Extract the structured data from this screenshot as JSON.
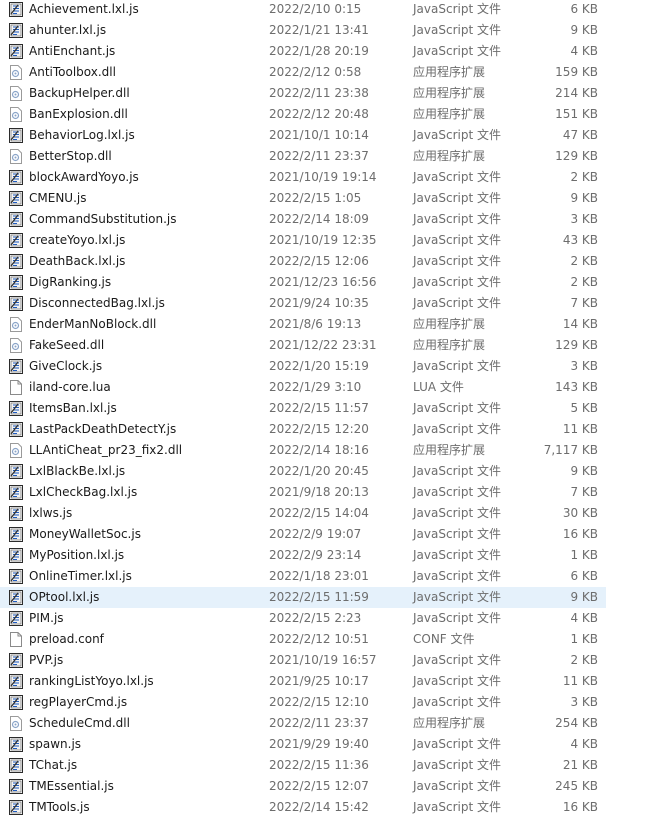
{
  "files": [
    {
      "name": "Achievement.lxl.js",
      "date": "2022/2/10 0:15",
      "type": "JavaScript 文件",
      "size": "6 KB",
      "icon": "javascript-file-icon"
    },
    {
      "name": "ahunter.lxl.js",
      "date": "2022/1/21 13:41",
      "type": "JavaScript 文件",
      "size": "9 KB",
      "icon": "javascript-file-icon"
    },
    {
      "name": "AntiEnchant.js",
      "date": "2022/1/28 20:19",
      "type": "JavaScript 文件",
      "size": "4 KB",
      "icon": "javascript-file-icon"
    },
    {
      "name": "AntiToolbox.dll",
      "date": "2022/2/12 0:58",
      "type": "应用程序扩展",
      "size": "159 KB",
      "icon": "dll-file-icon"
    },
    {
      "name": "BackupHelper.dll",
      "date": "2022/2/11 23:38",
      "type": "应用程序扩展",
      "size": "214 KB",
      "icon": "dll-file-icon"
    },
    {
      "name": "BanExplosion.dll",
      "date": "2022/2/12 20:48",
      "type": "应用程序扩展",
      "size": "151 KB",
      "icon": "dll-file-icon"
    },
    {
      "name": "BehaviorLog.lxl.js",
      "date": "2021/10/1 10:14",
      "type": "JavaScript 文件",
      "size": "47 KB",
      "icon": "javascript-file-icon"
    },
    {
      "name": "BetterStop.dll",
      "date": "2022/2/11 23:37",
      "type": "应用程序扩展",
      "size": "129 KB",
      "icon": "dll-file-icon"
    },
    {
      "name": "blockAwardYoyo.js",
      "date": "2021/10/19 19:14",
      "type": "JavaScript 文件",
      "size": "2 KB",
      "icon": "javascript-file-icon"
    },
    {
      "name": "CMENU.js",
      "date": "2022/2/15 1:05",
      "type": "JavaScript 文件",
      "size": "9 KB",
      "icon": "javascript-file-icon"
    },
    {
      "name": "CommandSubstitution.js",
      "date": "2022/2/14 18:09",
      "type": "JavaScript 文件",
      "size": "3 KB",
      "icon": "javascript-file-icon"
    },
    {
      "name": "createYoyo.lxl.js",
      "date": "2021/10/19 12:35",
      "type": "JavaScript 文件",
      "size": "43 KB",
      "icon": "javascript-file-icon"
    },
    {
      "name": "DeathBack.lxl.js",
      "date": "2022/2/15 12:06",
      "type": "JavaScript 文件",
      "size": "2 KB",
      "icon": "javascript-file-icon"
    },
    {
      "name": "DigRanking.js",
      "date": "2021/12/23 16:56",
      "type": "JavaScript 文件",
      "size": "2 KB",
      "icon": "javascript-file-icon"
    },
    {
      "name": "DisconnectedBag.lxl.js",
      "date": "2021/9/24 10:35",
      "type": "JavaScript 文件",
      "size": "7 KB",
      "icon": "javascript-file-icon"
    },
    {
      "name": "EnderManNoBlock.dll",
      "date": "2021/8/6 19:13",
      "type": "应用程序扩展",
      "size": "14 KB",
      "icon": "dll-file-icon"
    },
    {
      "name": "FakeSeed.dll",
      "date": "2021/12/22 23:31",
      "type": "应用程序扩展",
      "size": "129 KB",
      "icon": "dll-file-icon"
    },
    {
      "name": "GiveClock.js",
      "date": "2022/1/20 15:19",
      "type": "JavaScript 文件",
      "size": "3 KB",
      "icon": "javascript-file-icon"
    },
    {
      "name": "iland-core.lua",
      "date": "2022/1/29 3:10",
      "type": "LUA 文件",
      "size": "143 KB",
      "icon": "blank-file-icon"
    },
    {
      "name": "ItemsBan.lxl.js",
      "date": "2022/2/15 11:57",
      "type": "JavaScript 文件",
      "size": "5 KB",
      "icon": "javascript-file-icon"
    },
    {
      "name": "LastPackDeathDetectY.js",
      "date": "2022/2/15 12:20",
      "type": "JavaScript 文件",
      "size": "11 KB",
      "icon": "javascript-file-icon"
    },
    {
      "name": "LLAntiCheat_pr23_fix2.dll",
      "date": "2022/2/14 18:16",
      "type": "应用程序扩展",
      "size": "7,117 KB",
      "icon": "dll-file-icon"
    },
    {
      "name": "LxlBlackBe.lxl.js",
      "date": "2022/1/20 20:45",
      "type": "JavaScript 文件",
      "size": "9 KB",
      "icon": "javascript-file-icon"
    },
    {
      "name": "LxlCheckBag.lxl.js",
      "date": "2021/9/18 20:13",
      "type": "JavaScript 文件",
      "size": "7 KB",
      "icon": "javascript-file-icon"
    },
    {
      "name": "lxlws.js",
      "date": "2022/2/15 14:04",
      "type": "JavaScript 文件",
      "size": "30 KB",
      "icon": "javascript-file-icon"
    },
    {
      "name": "MoneyWalletSoc.js",
      "date": "2022/2/9 19:07",
      "type": "JavaScript 文件",
      "size": "16 KB",
      "icon": "javascript-file-icon"
    },
    {
      "name": "MyPosition.lxl.js",
      "date": "2022/2/9 23:14",
      "type": "JavaScript 文件",
      "size": "1 KB",
      "icon": "javascript-file-icon"
    },
    {
      "name": "OnlineTimer.lxl.js",
      "date": "2022/1/18 23:01",
      "type": "JavaScript 文件",
      "size": "6 KB",
      "icon": "javascript-file-icon"
    },
    {
      "name": "OPtool.lxl.js",
      "date": "2022/2/15 11:59",
      "type": "JavaScript 文件",
      "size": "9 KB",
      "icon": "javascript-file-icon",
      "selected": true
    },
    {
      "name": "PIM.js",
      "date": "2022/2/15 2:23",
      "type": "JavaScript 文件",
      "size": "4 KB",
      "icon": "javascript-file-icon"
    },
    {
      "name": "preload.conf",
      "date": "2022/2/12 10:51",
      "type": "CONF 文件",
      "size": "1 KB",
      "icon": "blank-file-icon"
    },
    {
      "name": "PVP.js",
      "date": "2021/10/19 16:57",
      "type": "JavaScript 文件",
      "size": "2 KB",
      "icon": "javascript-file-icon"
    },
    {
      "name": "rankingListYoyo.lxl.js",
      "date": "2021/9/25 10:17",
      "type": "JavaScript 文件",
      "size": "11 KB",
      "icon": "javascript-file-icon"
    },
    {
      "name": "regPlayerCmd.js",
      "date": "2022/2/15 12:10",
      "type": "JavaScript 文件",
      "size": "3 KB",
      "icon": "javascript-file-icon"
    },
    {
      "name": "ScheduleCmd.dll",
      "date": "2022/2/11 23:37",
      "type": "应用程序扩展",
      "size": "254 KB",
      "icon": "dll-file-icon"
    },
    {
      "name": "spawn.js",
      "date": "2021/9/29 19:40",
      "type": "JavaScript 文件",
      "size": "4 KB",
      "icon": "javascript-file-icon"
    },
    {
      "name": "TChat.js",
      "date": "2022/2/15 11:36",
      "type": "JavaScript 文件",
      "size": "21 KB",
      "icon": "javascript-file-icon"
    },
    {
      "name": "TMEssential.js",
      "date": "2022/2/15 12:07",
      "type": "JavaScript 文件",
      "size": "245 KB",
      "icon": "javascript-file-icon"
    },
    {
      "name": "TMTools.js",
      "date": "2022/2/14 15:42",
      "type": "JavaScript 文件",
      "size": "16 KB",
      "icon": "javascript-file-icon"
    }
  ]
}
